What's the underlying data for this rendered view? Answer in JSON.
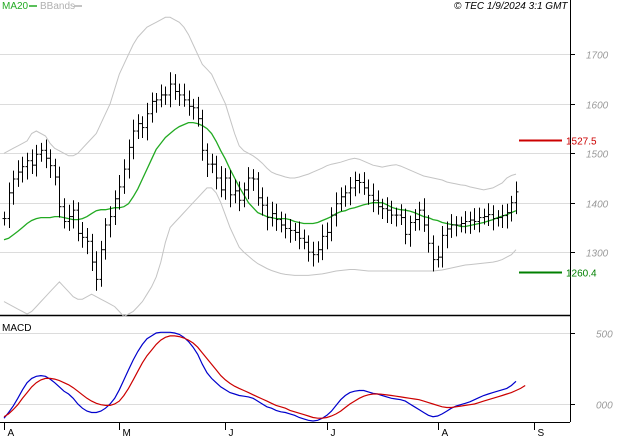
{
  "legend": {
    "ma_label": "MA20",
    "bbands_label": "BBands",
    "ma_color": "#22aa22",
    "bbands_color": "#b0b0b0"
  },
  "copyright": "© TEC 1/9/2024 3:1 GMT",
  "macd_label": "MACD",
  "chart_data": [
    {
      "type": "ohlc",
      "title": "",
      "ylim": [
        1175,
        1810
      ],
      "y_ticks": [
        {
          "value": 1700,
          "label": "1700"
        },
        {
          "value": 1600,
          "label": "1600"
        },
        {
          "value": 1500,
          "label": "1500"
        },
        {
          "value": 1400,
          "label": "1400"
        },
        {
          "value": 1300,
          "label": "1300"
        }
      ],
      "x_ticks": [
        "A",
        "M",
        "J",
        "J",
        "A",
        "S"
      ],
      "close": [
        1368,
        1420,
        1448,
        1462,
        1473,
        1485,
        1476,
        1498,
        1506,
        1490,
        1475,
        1452,
        1392,
        1362,
        1372,
        1385,
        1338,
        1330,
        1322,
        1280,
        1245,
        1305,
        1355,
        1372,
        1408,
        1432,
        1468,
        1512,
        1545,
        1560,
        1552,
        1580,
        1605,
        1608,
        1618,
        1618,
        1640,
        1625,
        1618,
        1608,
        1595,
        1592,
        1570,
        1506,
        1478,
        1478,
        1450,
        1426,
        1450,
        1416,
        1424,
        1405,
        1426,
        1450,
        1448,
        1410,
        1395,
        1370,
        1378,
        1366,
        1355,
        1348,
        1344,
        1340,
        1328,
        1320,
        1300,
        1295,
        1305,
        1332,
        1340,
        1375,
        1398,
        1412,
        1420,
        1430,
        1445,
        1441,
        1430,
        1415,
        1405,
        1392,
        1388,
        1385,
        1375,
        1375,
        1370,
        1336,
        1360,
        1366,
        1385,
        1355,
        1318,
        1285,
        1290,
        1334,
        1347,
        1355,
        1355,
        1358,
        1362,
        1365,
        1362,
        1370,
        1372,
        1376,
        1368,
        1370,
        1374,
        1380,
        1400,
        1422
      ],
      "bar_color": "#000000",
      "ma20": [
        1325,
        1328,
        1335,
        1342,
        1350,
        1358,
        1364,
        1368,
        1370,
        1370,
        1370,
        1372,
        1372,
        1370,
        1368,
        1366,
        1366,
        1368,
        1372,
        1378,
        1384,
        1386,
        1386,
        1388,
        1390,
        1390,
        1392,
        1398,
        1412,
        1428,
        1448,
        1468,
        1488,
        1508,
        1520,
        1532,
        1540,
        1548,
        1554,
        1558,
        1562,
        1562,
        1560,
        1556,
        1550,
        1540,
        1524,
        1505,
        1488,
        1468,
        1450,
        1432,
        1416,
        1400,
        1390,
        1380,
        1376,
        1372,
        1370,
        1368,
        1368,
        1368,
        1366,
        1362,
        1360,
        1358,
        1358,
        1358,
        1360,
        1364,
        1368,
        1372,
        1378,
        1382,
        1384,
        1388,
        1390,
        1393,
        1396,
        1398,
        1400,
        1400,
        1400,
        1396,
        1391,
        1388,
        1386,
        1385,
        1383,
        1380,
        1376,
        1372,
        1370,
        1366,
        1364,
        1360,
        1358,
        1356,
        1355,
        1352,
        1352,
        1354,
        1356,
        1358,
        1360,
        1363,
        1366,
        1370,
        1373,
        1376,
        1380,
        1384
      ],
      "bb_upper": [
        1500,
        1505,
        1510,
        1515,
        1520,
        1525,
        1540,
        1545,
        1540,
        1535,
        1520,
        1510,
        1505,
        1500,
        1495,
        1495,
        1500,
        1510,
        1520,
        1530,
        1540,
        1560,
        1580,
        1600,
        1630,
        1660,
        1680,
        1700,
        1720,
        1735,
        1745,
        1755,
        1760,
        1765,
        1770,
        1775,
        1775,
        1770,
        1765,
        1755,
        1740,
        1720,
        1700,
        1680,
        1670,
        1660,
        1640,
        1620,
        1600,
        1570,
        1540,
        1515,
        1505,
        1500,
        1495,
        1488,
        1480,
        1470,
        1462,
        1458,
        1455,
        1452,
        1450,
        1450,
        1452,
        1455,
        1458,
        1462,
        1466,
        1470,
        1475,
        1478,
        1480,
        1482,
        1485,
        1488,
        1490,
        1488,
        1484,
        1480,
        1476,
        1474,
        1472,
        1474,
        1476,
        1477,
        1474,
        1470,
        1466,
        1462,
        1458,
        1454,
        1452,
        1450,
        1448,
        1446,
        1442,
        1440,
        1438,
        1436,
        1435,
        1432,
        1430,
        1428,
        1426,
        1428,
        1430,
        1435,
        1440,
        1450,
        1455,
        1458
      ],
      "bb_lower": [
        1200,
        1195,
        1190,
        1185,
        1180,
        1175,
        1180,
        1190,
        1200,
        1210,
        1220,
        1230,
        1240,
        1230,
        1220,
        1210,
        1205,
        1205,
        1210,
        1215,
        1210,
        1205,
        1200,
        1195,
        1190,
        1180,
        1170,
        1175,
        1180,
        1190,
        1200,
        1215,
        1230,
        1250,
        1280,
        1320,
        1350,
        1360,
        1370,
        1380,
        1390,
        1400,
        1410,
        1420,
        1430,
        1430,
        1420,
        1400,
        1375,
        1350,
        1330,
        1310,
        1300,
        1292,
        1284,
        1277,
        1272,
        1267,
        1263,
        1260,
        1257,
        1255,
        1254,
        1253,
        1253,
        1253,
        1253,
        1254,
        1255,
        1256,
        1258,
        1260,
        1262,
        1263,
        1264,
        1265,
        1265,
        1264,
        1263,
        1262,
        1262,
        1262,
        1262,
        1262,
        1262,
        1262,
        1262,
        1262,
        1262,
        1262,
        1262,
        1262,
        1262,
        1262,
        1263,
        1264,
        1266,
        1268,
        1270,
        1272,
        1274,
        1275,
        1276,
        1277,
        1278,
        1279,
        1280,
        1282,
        1285,
        1290,
        1295,
        1305
      ],
      "support": {
        "value": 1260.4,
        "label": "1260.4",
        "color": "#008000"
      },
      "resistance": {
        "value": 1527.5,
        "label": "1527.5",
        "color": "#cc0000"
      }
    },
    {
      "type": "line",
      "title": "MACD",
      "ylim": [
        -120,
        620
      ],
      "y_ticks": [
        {
          "value": 500,
          "label": "500"
        },
        {
          "value": 0,
          "label": "000"
        }
      ],
      "series": [
        {
          "color": "#0000cc",
          "values": [
            -100,
            -60,
            -15,
            40,
            100,
            150,
            180,
            195,
            200,
            195,
            175,
            150,
            120,
            90,
            70,
            40,
            0,
            -30,
            -50,
            -60,
            -60,
            -50,
            -30,
            0,
            40,
            100,
            170,
            240,
            310,
            370,
            420,
            460,
            480,
            500,
            505,
            505,
            505,
            500,
            490,
            470,
            440,
            400,
            350,
            280,
            220,
            180,
            150,
            120,
            100,
            80,
            70,
            60,
            55,
            50,
            40,
            20,
            0,
            -20,
            -30,
            -45,
            -55,
            -60,
            -70,
            -80,
            -95,
            -105,
            -115,
            -120,
            -115,
            -100,
            -80,
            -50,
            -10,
            30,
            60,
            80,
            90,
            95,
            95,
            85,
            75,
            70,
            60,
            50,
            40,
            35,
            30,
            20,
            0,
            -20,
            -40,
            -60,
            -80,
            -90,
            -85,
            -70,
            -50,
            -30,
            -15,
            -5,
            5,
            15,
            30,
            45,
            60,
            70,
            80,
            90,
            100,
            110,
            130,
            160
          ]
        },
        {
          "color": "#cc0000",
          "values": [
            -90,
            -70,
            -40,
            -5,
            40,
            80,
            120,
            150,
            170,
            180,
            180,
            175,
            165,
            150,
            135,
            115,
            90,
            65,
            40,
            20,
            5,
            -5,
            -10,
            -10,
            0,
            20,
            60,
            110,
            170,
            230,
            290,
            340,
            380,
            420,
            450,
            470,
            480,
            480,
            475,
            465,
            450,
            430,
            400,
            360,
            320,
            280,
            240,
            200,
            170,
            145,
            125,
            110,
            95,
            80,
            65,
            50,
            35,
            20,
            5,
            -10,
            -20,
            -30,
            -45,
            -55,
            -65,
            -75,
            -85,
            -95,
            -100,
            -100,
            -95,
            -85,
            -70,
            -50,
            -25,
            0,
            20,
            40,
            55,
            65,
            70,
            70,
            68,
            64,
            60,
            55,
            50,
            45,
            40,
            35,
            30,
            20,
            10,
            0,
            -10,
            -20,
            -25,
            -25,
            -20,
            -15,
            -10,
            -5,
            0,
            10,
            20,
            30,
            40,
            50,
            60,
            70,
            80,
            95,
            110,
            130
          ]
        }
      ]
    }
  ]
}
